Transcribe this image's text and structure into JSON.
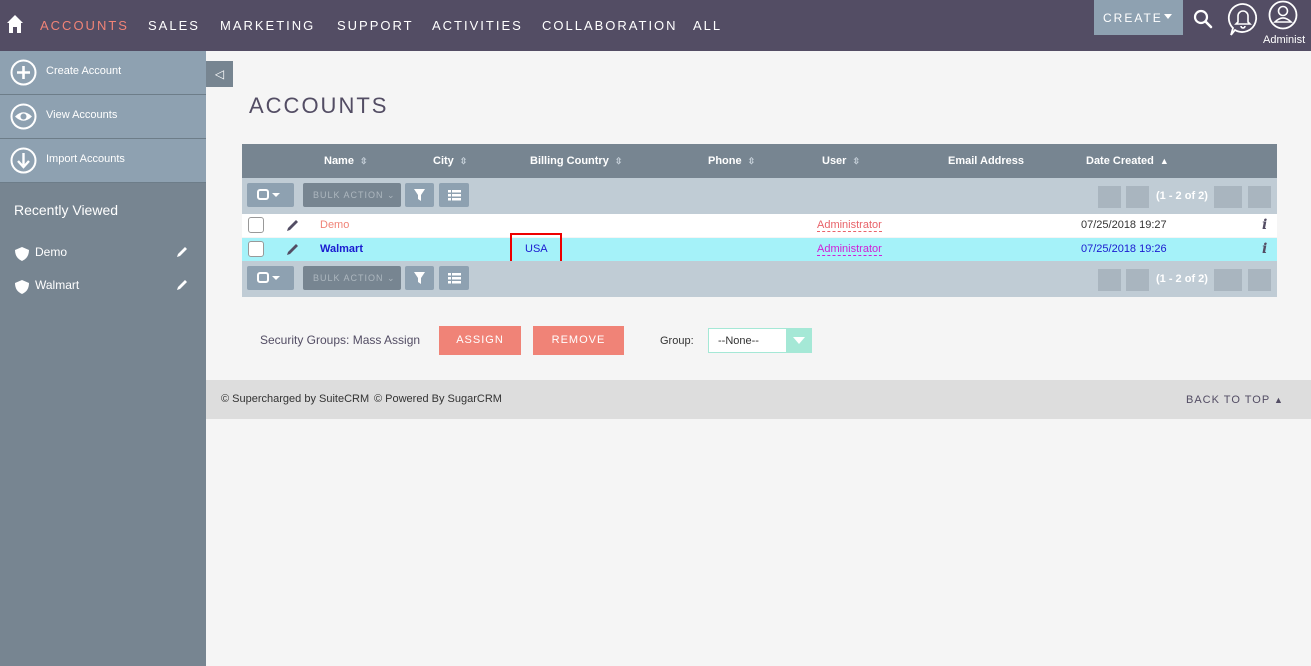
{
  "nav": {
    "items": [
      "ACCOUNTS",
      "SALES",
      "MARKETING",
      "SUPPORT",
      "ACTIVITIES",
      "COLLABORATION",
      "ALL"
    ],
    "create_label": "CREATE",
    "user_label": "Administ"
  },
  "sidebar": {
    "actions": [
      {
        "label": "Create Account",
        "icon": "plus-icon"
      },
      {
        "label": "View Accounts",
        "icon": "eye-icon"
      },
      {
        "label": "Import Accounts",
        "icon": "download-icon"
      }
    ],
    "recent_title": "Recently Viewed",
    "recent_items": [
      "Demo",
      "Walmart"
    ]
  },
  "page": {
    "title": "ACCOUNTS"
  },
  "table": {
    "columns": [
      "Name",
      "City",
      "Billing Country",
      "Phone",
      "User",
      "Email Address",
      "Date Created"
    ],
    "bulk_action_label": "BULK ACTION",
    "pagination": "(1 - 2 of 2)",
    "rows": [
      {
        "name": "Demo",
        "city": "",
        "billing_country": "",
        "phone": "",
        "user": "Administrator",
        "email": "",
        "date_created": "07/25/2018 19:27"
      },
      {
        "name": "Walmart",
        "city": "",
        "billing_country": "USA",
        "phone": "",
        "user": "Administrator",
        "email": "",
        "date_created": "07/25/2018 19:26"
      }
    ]
  },
  "mass_assign": {
    "label": "Security Groups: Mass Assign",
    "assign_label": "ASSIGN",
    "remove_label": "REMOVE",
    "group_label": "Group:",
    "group_value": "--None--"
  },
  "footer": {
    "supercharged": "© Supercharged by SuiteCRM",
    "powered": "© Powered By SugarCRM",
    "back_to_top": "BACK TO TOP"
  },
  "colors": {
    "nav_bg": "#534d64",
    "accent": "#f08377",
    "row_highlight": "#a5f2f9",
    "user_link": "#d01fd6",
    "link_blue": "#1a1ad0"
  }
}
